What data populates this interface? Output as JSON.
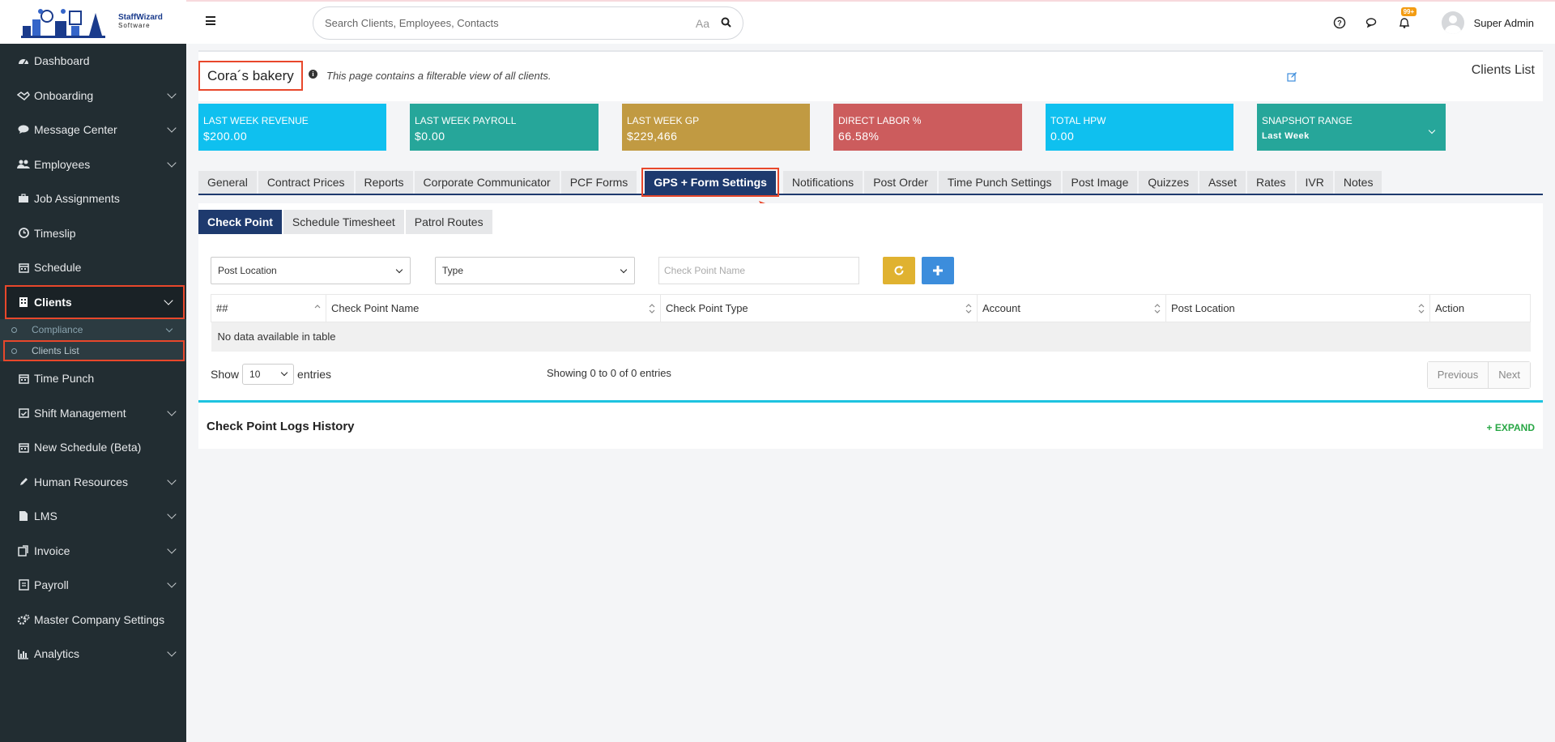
{
  "brand": {
    "name": "StaffWizard",
    "tagline": "Software"
  },
  "search": {
    "placeholder": "Search Clients, Employees, Contacts",
    "case_label": "Aa"
  },
  "user": {
    "name": "Super Admin",
    "notification_count": "99+"
  },
  "sidebar": {
    "items": [
      {
        "label": "Dashboard",
        "icon": "dashboard-icon",
        "chevron": false
      },
      {
        "label": "Onboarding",
        "icon": "handshake-icon",
        "chevron": true
      },
      {
        "label": "Message Center",
        "icon": "chat-icon",
        "chevron": true
      },
      {
        "label": "Employees",
        "icon": "users-icon",
        "chevron": true
      },
      {
        "label": "Job Assignments",
        "icon": "briefcase-icon",
        "chevron": false
      },
      {
        "label": "Timeslip",
        "icon": "clock-icon",
        "chevron": false
      },
      {
        "label": "Schedule",
        "icon": "calendar-icon",
        "chevron": false
      },
      {
        "label": "Clients",
        "icon": "building-icon",
        "chevron": true
      },
      {
        "label": "Time Punch",
        "icon": "calendar-icon",
        "chevron": false
      },
      {
        "label": "Shift Management",
        "icon": "calendar-check-icon",
        "chevron": true
      },
      {
        "label": "New Schedule (Beta)",
        "icon": "calendar-icon",
        "chevron": false
      },
      {
        "label": "Human Resources",
        "icon": "pencil-icon",
        "chevron": true
      },
      {
        "label": "LMS",
        "icon": "book-icon",
        "chevron": true
      },
      {
        "label": "Invoice",
        "icon": "invoice-icon",
        "chevron": true
      },
      {
        "label": "Payroll",
        "icon": "payroll-icon",
        "chevron": true
      },
      {
        "label": "Master Company Settings",
        "icon": "gears-icon",
        "chevron": false
      },
      {
        "label": "Analytics",
        "icon": "bar-chart-icon",
        "chevron": true
      }
    ],
    "clients_sub": [
      {
        "label": "Compliance"
      },
      {
        "label": "Clients List"
      }
    ]
  },
  "header": {
    "client_name": "Cora´s bakery",
    "description": "This page contains a filterable view of all clients.",
    "list_title": "Clients List"
  },
  "stats": [
    {
      "title": "LAST WEEK REVENUE",
      "value": "$200.00",
      "color": "#0fc0ef"
    },
    {
      "title": "LAST WEEK PAYROLL",
      "value": "$0.00",
      "color": "#26a69a"
    },
    {
      "title": "LAST WEEK GP",
      "value": "$229,466",
      "color": "#c19a42"
    },
    {
      "title": "DIRECT LABOR %",
      "value": "66.58%",
      "color": "#cc5c5d"
    },
    {
      "title": "TOTAL HPW",
      "value": "0.00",
      "color": "#0fc0ef"
    },
    {
      "title": "SNAPSHOT RANGE",
      "value": "Last Week",
      "color": "#26a69a"
    }
  ],
  "tabs": [
    "General",
    "Contract Prices",
    "Reports",
    "Corporate Communicator",
    "PCF Forms",
    "GPS + Form Settings",
    "Notifications",
    "Post Order",
    "Time Punch Settings",
    "Post Image",
    "Quizzes",
    "Asset",
    "Rates",
    "IVR",
    "Notes"
  ],
  "subtabs": [
    "Check Point",
    "Schedule Timesheet",
    "Patrol Routes"
  ],
  "filters": {
    "post_location": "Post Location",
    "type": "Type",
    "name_placeholder": "Check Point Name",
    "refresh_color": "#e0b230",
    "add_color": "#3c8ddc"
  },
  "table": {
    "columns": [
      "##",
      "Check Point Name",
      "Check Point Type",
      "Account",
      "Post Location",
      "Action"
    ],
    "empty": "No data available in table"
  },
  "footer": {
    "show": "Show",
    "length": "10",
    "entries": "entries",
    "info": "Showing 0 to 0 of 0 entries",
    "previous": "Previous",
    "next": "Next"
  },
  "logs": {
    "title": "Check Point Logs History",
    "expand": "+ EXPAND"
  }
}
